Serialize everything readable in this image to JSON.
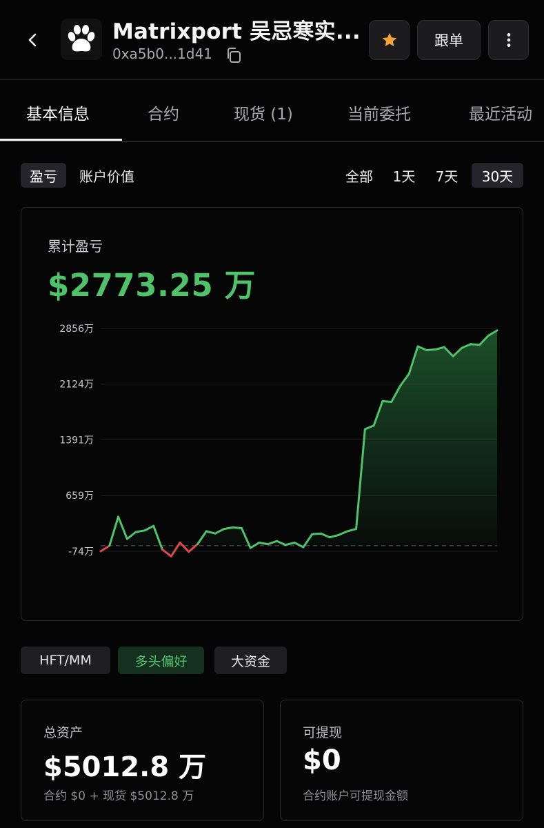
{
  "header": {
    "title": "Matrixport 吴忌寒实...",
    "address": "0xa5b0...1d41",
    "follow_label": "跟单"
  },
  "tabs": [
    {
      "label": "基本信息",
      "active": true
    },
    {
      "label": "合约",
      "active": false
    },
    {
      "label": "现货 (1)",
      "active": false
    },
    {
      "label": "当前委托",
      "active": false
    },
    {
      "label": "最近活动",
      "active": false
    }
  ],
  "chart_modes": {
    "metric": [
      {
        "label": "盈亏",
        "active": true
      },
      {
        "label": "账户价值",
        "active": false
      }
    ],
    "range": [
      {
        "label": "全部",
        "active": false
      },
      {
        "label": "1天",
        "active": false
      },
      {
        "label": "7天",
        "active": false
      },
      {
        "label": "30天",
        "active": true
      }
    ]
  },
  "pnl": {
    "label": "累计盈亏",
    "value": "$2773.25 万"
  },
  "chart_data": {
    "type": "area",
    "y_unit": "万",
    "y_ticks": [
      "2856万",
      "2124万",
      "1391万",
      "659万",
      "-74万"
    ],
    "y_tick_values": [
      2856,
      2124,
      1391,
      659,
      -74
    ],
    "ylim": [
      -74,
      2856
    ],
    "baseline": 0,
    "positive_color": "#4ec36a",
    "negative_color": "#e0484c",
    "values": [
      -74,
      0,
      380,
      90,
      180,
      200,
      260,
      -50,
      -140,
      40,
      -80,
      20,
      190,
      160,
      220,
      240,
      230,
      -30,
      40,
      20,
      60,
      10,
      40,
      -20,
      150,
      160,
      110,
      140,
      190,
      220,
      1530,
      1580,
      1900,
      1890,
      2100,
      2260,
      2620,
      2570,
      2580,
      2610,
      2490,
      2600,
      2650,
      2640,
      2760,
      2830
    ]
  },
  "tags": [
    {
      "label": "HFT/MM",
      "style": "neutral"
    },
    {
      "label": "多头偏好",
      "style": "green"
    },
    {
      "label": "大资金",
      "style": "neutral"
    }
  ],
  "stats": {
    "total_assets": {
      "label": "总资产",
      "value": "$5012.8 万",
      "sub": "合约 $0 + 现货 $5012.8 万"
    },
    "withdrawable": {
      "label": "可提现",
      "value": "$0",
      "sub": "合约账户可提现金额"
    }
  },
  "colors": {
    "accent_green": "#4ec36a",
    "star": "#f2a33a",
    "background": "#050506"
  }
}
